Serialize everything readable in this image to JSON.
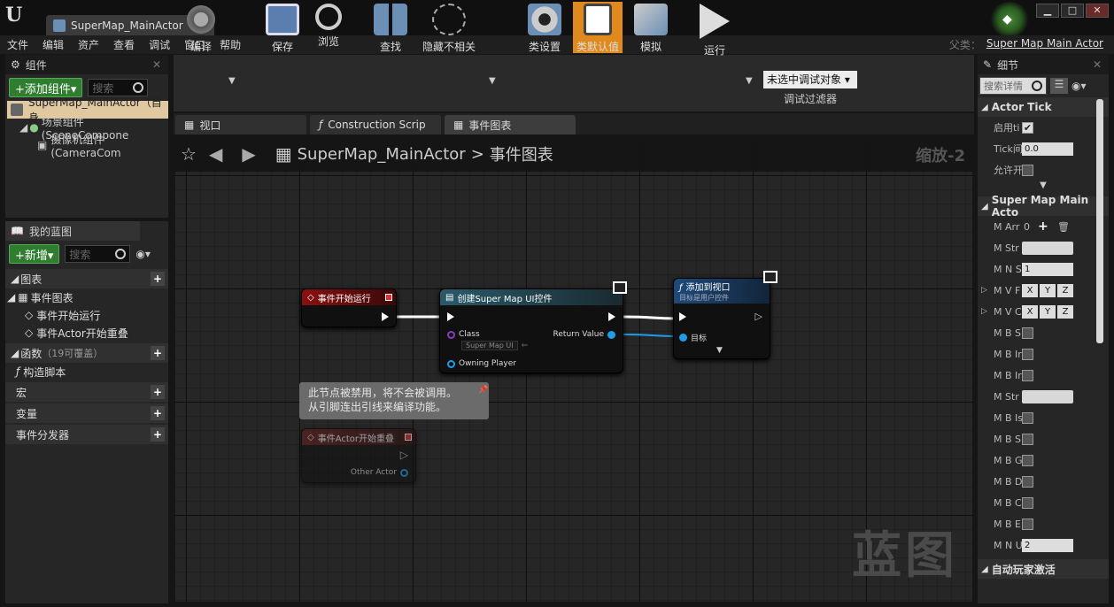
{
  "window": {
    "tab_title": "SuperMap_MainActor",
    "parent_label": "父类：",
    "parent_value": "Super Map Main Actor"
  },
  "menu": [
    "文件",
    "编辑",
    "资产",
    "查看",
    "调试",
    "窗口",
    "帮助"
  ],
  "components": {
    "title": "组件",
    "add_button": "+添加组件▾",
    "search_placeholder": "搜索",
    "root": "SuperMap_MainActor（自身",
    "tree": [
      "场景组件 (SceneCompone",
      "摄像机组件 (CameraCom"
    ]
  },
  "my_blueprint": {
    "title": "我的蓝图",
    "add_button": "+新增▾",
    "search_placeholder": "搜索",
    "sections": {
      "graphs": "图表",
      "event_graph": "事件图表",
      "events": [
        "事件开始运行",
        "事件Actor开始重叠"
      ],
      "functions": "函数",
      "functions_note": "（19可覆盖）",
      "construction": "构造脚本",
      "macros": "宏",
      "variables": "变量",
      "dispatchers": "事件分发器"
    }
  },
  "toolbar": {
    "compile": "编译",
    "save": "保存",
    "browse": "浏览",
    "find": "查找",
    "hide": "隐藏不相关",
    "class_settings": "类设置",
    "class_defaults": "类默认值",
    "simulate": "模拟",
    "play": "运行",
    "debug_select": "未选中调试对象 ▾",
    "debug_filter": "调试过滤器"
  },
  "editor_tabs": [
    "视口",
    "Construction Scrip",
    "事件图表"
  ],
  "graph": {
    "breadcrumb_root": "SuperMap_MainActor",
    "breadcrumb_sep": ">",
    "breadcrumb_leaf": "事件图表",
    "zoom": "缩放-2",
    "watermark": "蓝图"
  },
  "nodes": {
    "begin_play": "事件开始运行",
    "create_widget": "创建Super Map UI控件",
    "class_label": "Class",
    "class_value": "Super Map UI",
    "owning_player": "Owning Player",
    "return_value": "Return Value",
    "add_viewport": "添加到视口",
    "add_viewport_sub": "目标是用户控件",
    "target": "目标",
    "overlap": "事件Actor开始重叠",
    "other_actor": "Other Actor",
    "comment": "此节点被禁用，将不会被调用。\n从引脚连出引线来编译功能。"
  },
  "details": {
    "title": "细节",
    "search_placeholder": "搜索详情",
    "section_tick": "Actor Tick",
    "tick_rows": [
      {
        "label": "启用ti",
        "type": "check",
        "checked": true
      },
      {
        "label": "Tick间",
        "type": "num",
        "value": "0.0"
      },
      {
        "label": "允许开",
        "type": "check",
        "checked": false
      }
    ],
    "section_main": "Super Map Main Acto",
    "main_rows": [
      {
        "label": "M Arr",
        "type": "array",
        "value": "0"
      },
      {
        "label": "M Str",
        "type": "text"
      },
      {
        "label": "M N S",
        "type": "num",
        "value": "1"
      },
      {
        "label": "M V F",
        "type": "vec"
      },
      {
        "label": "M V C",
        "type": "vec"
      },
      {
        "label": "M B S",
        "type": "check"
      },
      {
        "label": "M B Ir",
        "type": "check"
      },
      {
        "label": "M B Ir",
        "type": "check"
      },
      {
        "label": "M Str",
        "type": "text"
      },
      {
        "label": "M B Is",
        "type": "check"
      },
      {
        "label": "M B S",
        "type": "check"
      },
      {
        "label": "M B G",
        "type": "check"
      },
      {
        "label": "M B D",
        "type": "check"
      },
      {
        "label": "M B C",
        "type": "check"
      },
      {
        "label": "M B E",
        "type": "check"
      },
      {
        "label": "M N U",
        "type": "num",
        "value": "2"
      }
    ],
    "vec_labels": [
      "X",
      "Y",
      "Z"
    ],
    "section_bottom": "自动玩家激活"
  }
}
